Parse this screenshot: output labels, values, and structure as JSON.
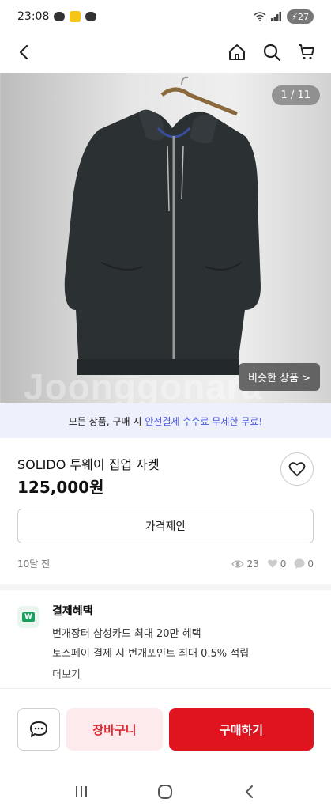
{
  "status_bar": {
    "time": "23:08",
    "battery": "27"
  },
  "header": {
    "back_icon": "back-arrow-icon",
    "home_icon": "home-icon",
    "search_icon": "search-icon",
    "cart_icon": "cart-icon"
  },
  "image": {
    "counter": "1 / 11",
    "similar_label": "비슷한 상품 >",
    "watermark": "Joonggonara"
  },
  "promo": {
    "text_prefix": "모든 상품, 구매 시",
    "text_highlight": "안전결제 수수료 무제한 무료!"
  },
  "product": {
    "title": "SOLIDO 투웨이 집업 자켓",
    "price": "125,000원"
  },
  "offer_button_label": "가격제안",
  "meta": {
    "posted": "10달 전",
    "views": "23",
    "likes": "0",
    "chats": "0"
  },
  "benefit": {
    "badge": "W",
    "title": "결제혜택",
    "lines": [
      "번개장터 삼성카드 최대 20만 혜택",
      "토스페이 결제 시 번개포인트 최대 0.5% 적립"
    ],
    "more": "더보기"
  },
  "bottom": {
    "cart_label": "장바구니",
    "buy_label": "구매하기"
  },
  "colors": {
    "accent": "#e0141f",
    "promo_highlight": "#4a56e2",
    "cart_bg": "#fdeaec"
  }
}
